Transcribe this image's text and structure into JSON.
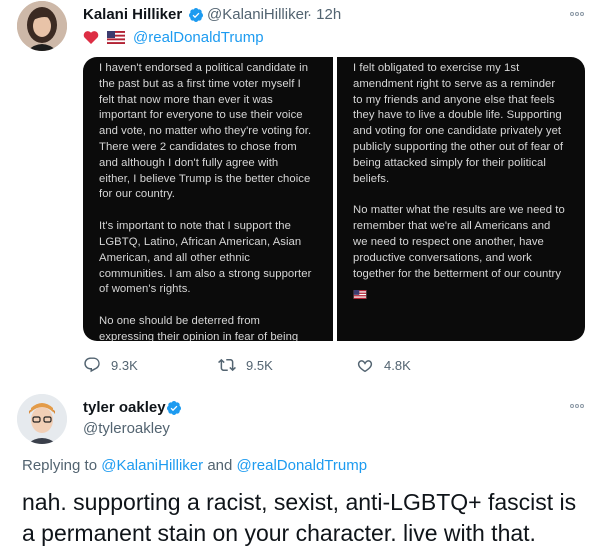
{
  "tweet": {
    "author": {
      "name": "Kalani Hilliker",
      "handle": "@KalaniHilliker",
      "time": "· 12h"
    },
    "bio_mention": "@realDonaldTrump",
    "image_left_paragraphs": [
      "I haven't endorsed a political candidate in\nthe past but as a first time voter myself I\nfelt that now more than ever it was\nimportant for everyone to use their voice\nand vote, no matter who they're voting for.\nThere were 2 candidates to chose from\nand although I don't fully agree with\neither, I believe Trump is the better choice\nfor our country.",
      "It's important to note that I support the\nLGBTQ, Latino, African American, Asian\nAmerican, and all other ethnic\ncommunities. I am also a strong supporter\nof women's rights.",
      "No one should be deterred from\nexpressing their opinion in fear of being"
    ],
    "image_right_paragraphs": [
      "I felt obligated to exercise my 1st\namendment right to serve as a reminder\nto my friends and anyone else that feels\nthey have to live a double life. Supporting\nand voting for one candidate privately yet\npublicly supporting the other out of fear of\nbeing attacked simply for their political\nbeliefs.",
      "No matter what the results are we need to\nremember that we're all Americans and\nwe need to respect one another, have\nproductive conversations, and work\ntogether for the betterment of our country"
    ],
    "actions": {
      "replies": "9.3K",
      "retweets": "9.5K",
      "likes": "4.8K"
    }
  },
  "reply": {
    "author": {
      "name": "tyler oakley",
      "handle": "@tyleroakley"
    },
    "replying_prefix": "Replying to ",
    "replying_to_1": "@KalaniHilliker",
    "replying_and": " and ",
    "replying_to_2": "@realDonaldTrump",
    "text": "nah. supporting a racist, sexist, anti-LGBTQ+ fascist is a permanent stain on your character. live with that."
  },
  "colors": {
    "accent": "#1d9bf0",
    "secondary_text": "#536471",
    "heart": "#e0245e"
  },
  "icons": [
    "more-options-icon",
    "verified-badge-icon",
    "heart-emoji-icon",
    "us-flag-emoji-icon",
    "reply-icon",
    "retweet-icon",
    "like-icon"
  ]
}
